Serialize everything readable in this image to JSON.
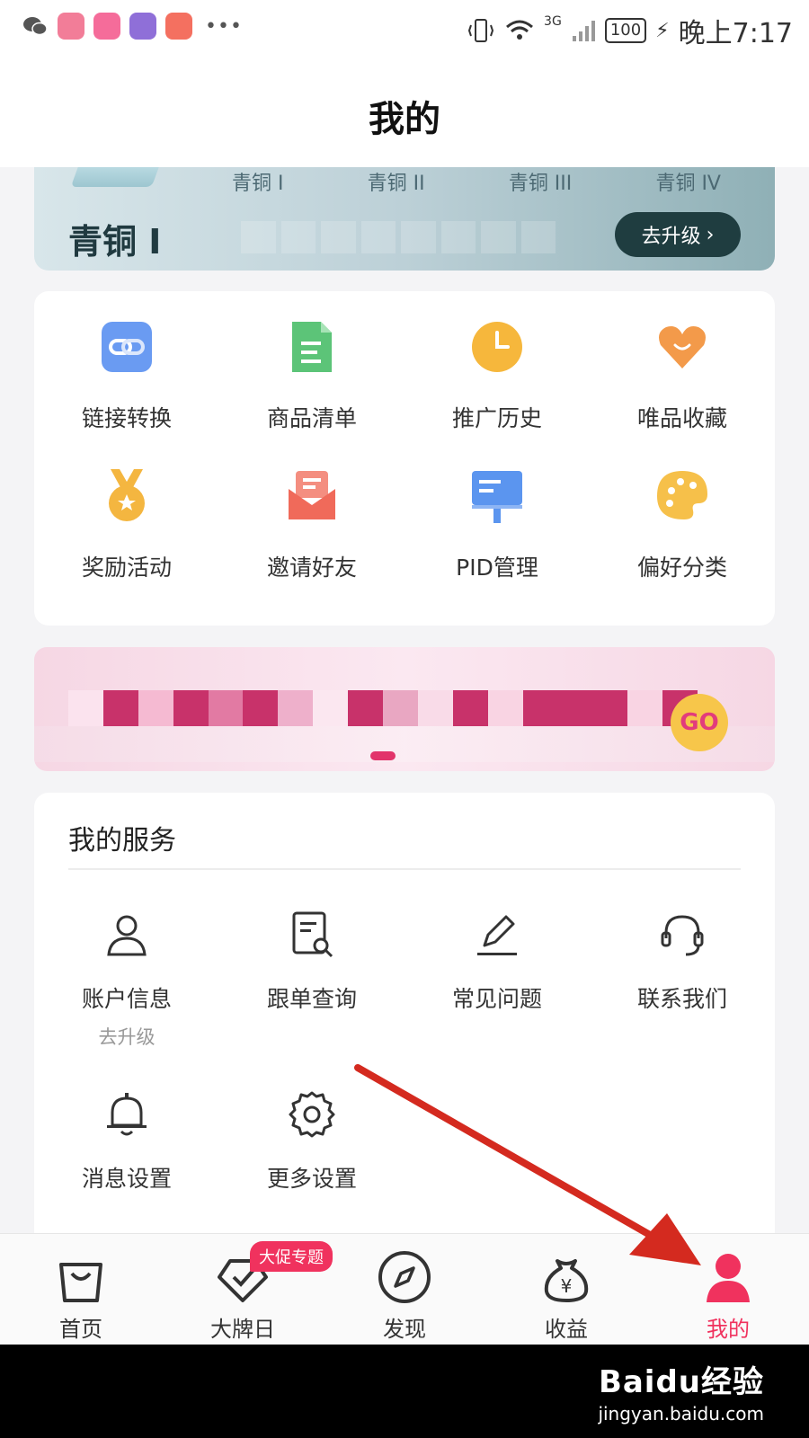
{
  "status_bar": {
    "time": "晚上7:17",
    "battery": "100",
    "network": "3G"
  },
  "header": {
    "title": "我的"
  },
  "level": {
    "tiers": [
      "青铜 I",
      "青铜 II",
      "青铜 III",
      "青铜 IV"
    ],
    "current": "青铜 I",
    "upgrade_label": "去升级"
  },
  "tools": [
    {
      "label": "链接转换",
      "icon": "link-icon",
      "color": "#6a9bf2"
    },
    {
      "label": "商品清单",
      "icon": "document-list-icon",
      "color": "#5cc478"
    },
    {
      "label": "推广历史",
      "icon": "clock-icon",
      "color": "#f6b73c"
    },
    {
      "label": "唯品收藏",
      "icon": "heart-icon",
      "color": "#f39a4a"
    },
    {
      "label": "奖励活动",
      "icon": "medal-icon",
      "color": "#f4b640"
    },
    {
      "label": "邀请好友",
      "icon": "envelope-icon",
      "color": "#f06a5a"
    },
    {
      "label": "PID管理",
      "icon": "billboard-icon",
      "color": "#5b95ef"
    },
    {
      "label": "偏好分类",
      "icon": "palette-icon",
      "color": "#f6c04a"
    }
  ],
  "banner": {
    "cta": "GO"
  },
  "services": {
    "title": "我的服务",
    "items": [
      {
        "label": "账户信息",
        "sub": "去升级",
        "icon": "user-outline-icon"
      },
      {
        "label": "跟单查询",
        "icon": "order-search-icon"
      },
      {
        "label": "常见问题",
        "icon": "pencil-icon"
      },
      {
        "label": "联系我们",
        "icon": "headset-icon"
      },
      {
        "label": "消息设置",
        "icon": "bell-icon"
      },
      {
        "label": "更多设置",
        "icon": "gear-icon"
      }
    ]
  },
  "tabbar": {
    "items": [
      {
        "label": "首页",
        "icon": "shopping-bag-icon"
      },
      {
        "label": "大牌日",
        "icon": "tag-check-icon",
        "badge": "大促专题"
      },
      {
        "label": "发现",
        "icon": "compass-icon"
      },
      {
        "label": "收益",
        "icon": "money-bag-icon"
      },
      {
        "label": "我的",
        "icon": "user-filled-icon",
        "active": true
      }
    ]
  },
  "watermark": {
    "logo": "Baidu经验",
    "url": "jingyan.baidu.com"
  },
  "colors": {
    "accent": "#f0325e",
    "level_button": "#1f3d40",
    "annotation_arrow": "#d42a1f"
  }
}
